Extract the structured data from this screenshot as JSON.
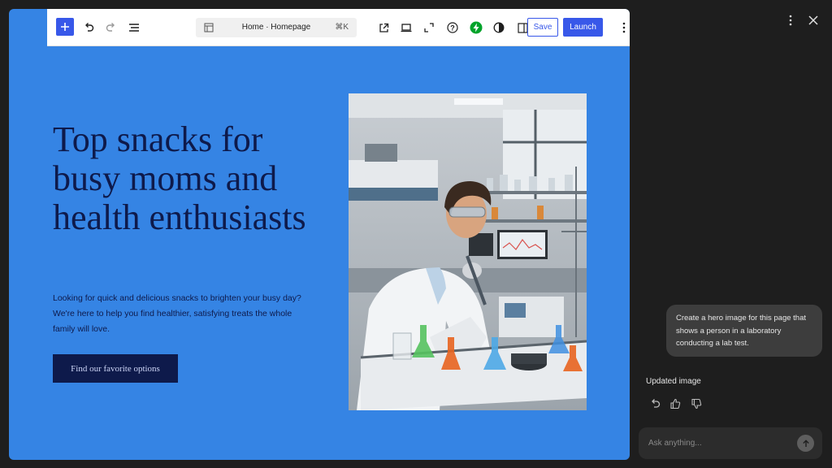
{
  "toolbar": {
    "document_title": "Home · Homepage",
    "shortcut": "⌘K",
    "save_label": "Save",
    "launch_label": "Launch"
  },
  "hero": {
    "heading": "Top snacks for busy moms and health enthusiasts",
    "body": "Looking for quick and delicious snacks to brighten your busy day? We're here to help you find healthier, satisfying treats the whole family will love.",
    "cta": "Find our favorite options",
    "image_subject": "scientist-in-laboratory"
  },
  "assistant": {
    "user_prompt": "Create a hero image for this page that shows a person in a laboratory conducting a lab test.",
    "response_label": "Updated image",
    "input_placeholder": "Ask anything..."
  },
  "icons": {
    "logo": "wordpress-logo-icon",
    "add": "plus-icon",
    "undo": "undo-icon",
    "redo": "redo-icon",
    "outline": "list-view-icon",
    "document": "page-layout-icon",
    "external": "external-link-icon",
    "device": "laptop-icon",
    "fullscreen": "expand-icon",
    "help": "help-icon",
    "performance": "bolt-icon",
    "contrast": "contrast-icon",
    "sidebar": "sidebar-toggle-icon",
    "more": "more-vertical-icon",
    "close": "close-icon",
    "send": "arrow-up-icon"
  },
  "colors": {
    "canvas": "#3584e4",
    "accent": "#3858e9",
    "heading": "#0e1a4b",
    "sidebar_bg": "#1e1e1e",
    "bolt": "#00a32a"
  }
}
